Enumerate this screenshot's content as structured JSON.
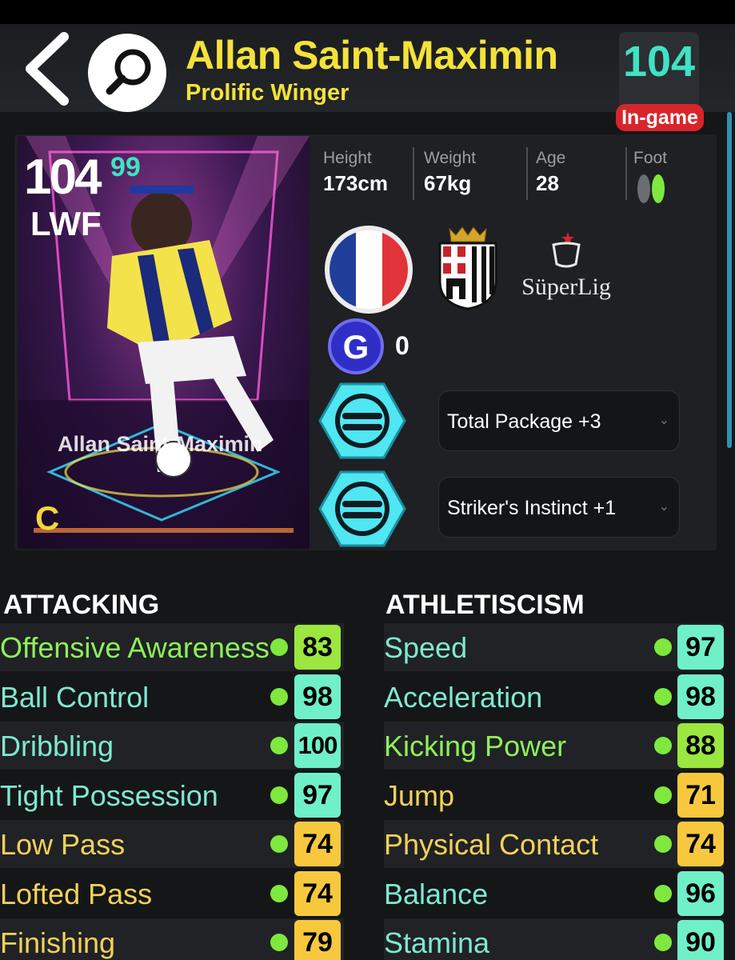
{
  "header": {
    "player_name": "Allan Saint-Maximin",
    "playing_style": "Prolific Winger",
    "overall": "104",
    "overall_badge": "In-game"
  },
  "card": {
    "rating": "104",
    "rating_sub": "99",
    "position": "LWF",
    "name": "Allan Saint-Maximin",
    "grade": "C"
  },
  "info": {
    "height_label": "Height",
    "height_value": "173cm",
    "weight_label": "Weight",
    "weight_value": "67kg",
    "age_label": "Age",
    "age_value": "28",
    "foot_label": "Foot"
  },
  "league": {
    "name": "SüperLig"
  },
  "g_count": "0",
  "skills": [
    {
      "label": "Total Package +3"
    },
    {
      "label": "Striker's Instinct +1"
    }
  ],
  "colors": {
    "accent_yellow": "#f4e23a",
    "accent_teal": "#3fe3c3",
    "value_teal": "#6ff0c9",
    "value_green": "#9be63f",
    "value_yellow": "#f7c83e",
    "label_green": "#8ef05a",
    "label_teal": "#7fe8d2",
    "label_yellow": "#f2d15a"
  },
  "attacking": {
    "title": "ATTACKING",
    "stats": [
      {
        "label": "Offensive Awareness",
        "value": "83",
        "tier": "green"
      },
      {
        "label": "Ball Control",
        "value": "98",
        "tier": "teal"
      },
      {
        "label": "Dribbling",
        "value": "100",
        "tier": "teal"
      },
      {
        "label": "Tight Possession",
        "value": "97",
        "tier": "teal"
      },
      {
        "label": "Low Pass",
        "value": "74",
        "tier": "yellow"
      },
      {
        "label": "Lofted Pass",
        "value": "74",
        "tier": "yellow"
      },
      {
        "label": "Finishing",
        "value": "79",
        "tier": "yellow"
      }
    ]
  },
  "athleticism": {
    "title": "ATHLETISCISM",
    "stats": [
      {
        "label": "Speed",
        "value": "97",
        "tier": "teal"
      },
      {
        "label": "Acceleration",
        "value": "98",
        "tier": "teal"
      },
      {
        "label": "Kicking Power",
        "value": "88",
        "tier": "green"
      },
      {
        "label": "Jump",
        "value": "71",
        "tier": "yellow"
      },
      {
        "label": "Physical Contact",
        "value": "74",
        "tier": "yellow"
      },
      {
        "label": "Balance",
        "value": "96",
        "tier": "teal"
      },
      {
        "label": "Stamina",
        "value": "90",
        "tier": "teal"
      }
    ]
  }
}
